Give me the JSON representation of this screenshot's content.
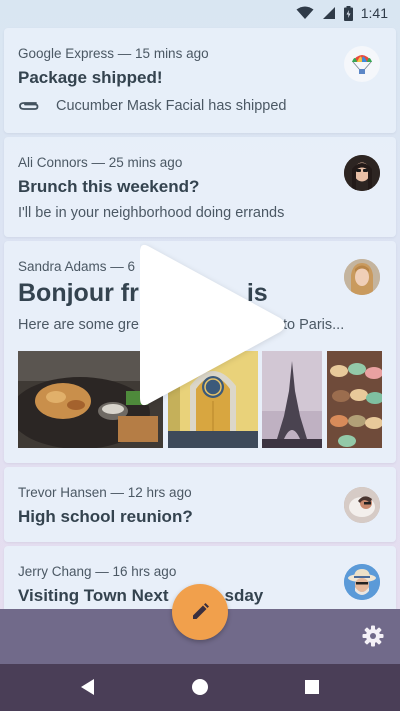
{
  "status_bar": {
    "time": "1:41",
    "icons": [
      "wifi-icon",
      "signal-icon",
      "battery-icon"
    ]
  },
  "emails": [
    {
      "sender_time": "Google Express — 15 mins ago",
      "subject": "Package shipped!",
      "preview": "Cucumber Mask Facial has shipped",
      "attachment_icon": "paperclip-icon",
      "avatar": "parachute-avatar"
    },
    {
      "sender_time": "Ali Connors — 25 mins ago",
      "subject": "Brunch this weekend?",
      "preview": "I'll be in your neighborhood doing errands",
      "avatar": "ali-avatar"
    },
    {
      "sender_time": "Sandra Adams — 6",
      "subject_left": "Bonjour fr",
      "subject_right": "is",
      "preview_left": "Here are some gre",
      "preview_right": "p to Paris...",
      "avatar": "sandra-avatar",
      "photos": [
        "food-photo",
        "door-photo",
        "eiffel-tower-photo",
        "macarons-photo"
      ]
    },
    {
      "sender_time": "Trevor Hansen — 12 hrs ago",
      "subject": "High school reunion?",
      "avatar": "trevor-avatar"
    },
    {
      "sender_time": "Jerry Chang — 16 hrs ago",
      "subject_left": "Visiting Town Next",
      "subject_right": "sday",
      "avatar": "jerry-avatar"
    }
  ],
  "colors": {
    "fab": "#f1a04c",
    "bottom_bar": "#716a8a",
    "nav_bar": "#4a3e57"
  },
  "controls": [
    "play-icon",
    "compose-icon",
    "settings-icon",
    "back-icon",
    "home-icon",
    "recents-icon"
  ]
}
